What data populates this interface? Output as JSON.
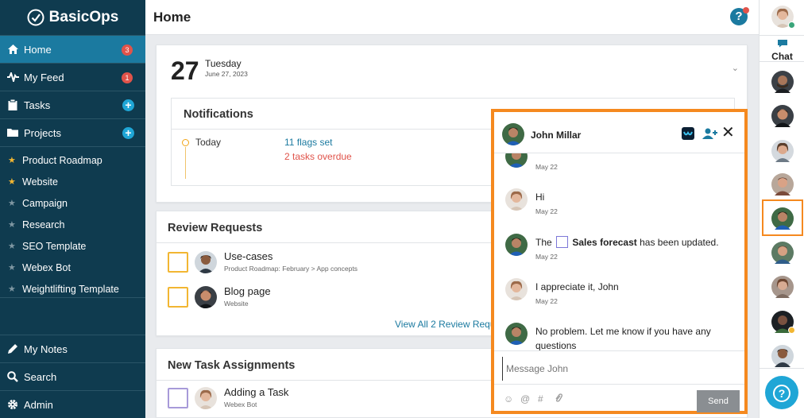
{
  "app": {
    "logo_text": "BasicOps"
  },
  "sidebar": {
    "nav": [
      {
        "label": "Home",
        "badge": "3",
        "icon": "home-icon"
      },
      {
        "label": "My Feed",
        "badge": "1",
        "icon": "pulse-icon"
      },
      {
        "label": "Tasks",
        "icon": "clipboard-icon"
      },
      {
        "label": "Projects",
        "icon": "folder-icon"
      }
    ],
    "projects": [
      {
        "label": "Product Roadmap",
        "favorite": true
      },
      {
        "label": "Website",
        "favorite": true
      },
      {
        "label": "Campaign",
        "favorite": false
      },
      {
        "label": "Research",
        "favorite": false
      },
      {
        "label": "SEO Template",
        "favorite": false
      },
      {
        "label": "Webex Bot",
        "favorite": false
      },
      {
        "label": "Weightlifting Template",
        "favorite": false
      }
    ],
    "bottom": [
      {
        "label": "My Notes",
        "icon": "pencil-icon"
      },
      {
        "label": "Search",
        "icon": "search-icon"
      },
      {
        "label": "Admin",
        "icon": "gear-icon"
      }
    ]
  },
  "header": {
    "title": "Home",
    "help_glyph": "?"
  },
  "date_card": {
    "day": "27",
    "weekday": "Tuesday",
    "full_date": "June 27, 2023"
  },
  "notifications": {
    "title": "Notifications",
    "period": "Today",
    "flags": "11 flags set",
    "overdue": "2 tasks overdue"
  },
  "review_requests": {
    "title": "Review Requests",
    "items": [
      {
        "title": "Use-cases",
        "subtitle": "Product Roadmap: February  >  App concepts"
      },
      {
        "title": "Blog page",
        "subtitle": "Website"
      }
    ],
    "view_all": "View All 2 Review Requ"
  },
  "new_tasks": {
    "title": "New Task Assignments",
    "items": [
      {
        "title": "Adding a Task",
        "subtitle": "Webex Bot"
      }
    ]
  },
  "chat": {
    "contact": "John Millar",
    "messages": [
      {
        "sender": "john",
        "text": "",
        "date": "May 22"
      },
      {
        "sender": "me",
        "text": "Hi",
        "date": "May 22"
      },
      {
        "sender": "john",
        "text_before": "The",
        "bold": "Sales forecast",
        "text_after": "has been updated.",
        "date": "May 22"
      },
      {
        "sender": "me",
        "text": "I appreciate it, John",
        "date": "May 22"
      },
      {
        "sender": "john",
        "text": "No problem. Let me know if you have any questions",
        "date": ""
      }
    ],
    "input_placeholder": "Message John",
    "send_label": "Send"
  },
  "rail": {
    "chat_label": "Chat"
  },
  "colors": {
    "sidebar": "#0f3b4f",
    "active": "#1b7aa0",
    "accent": "#f5891f",
    "link": "#1b7aa0",
    "danger": "#e0534a"
  }
}
